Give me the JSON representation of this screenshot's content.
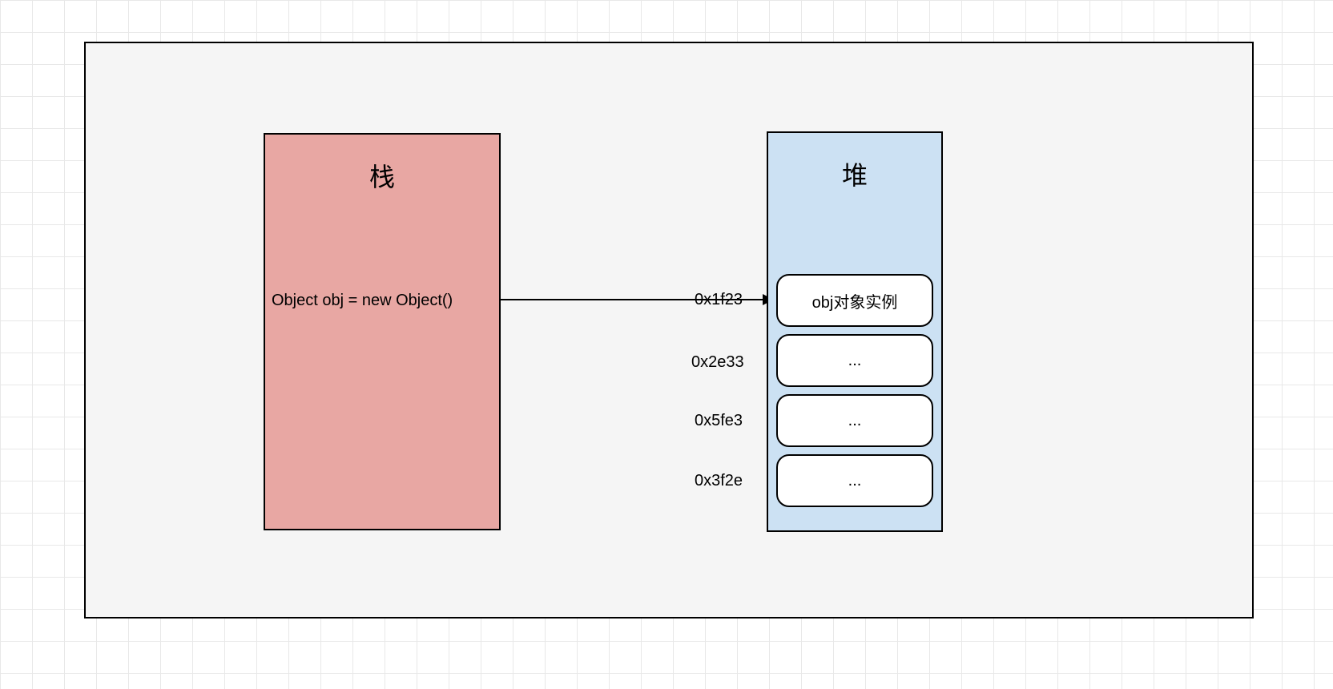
{
  "stack": {
    "title": "栈",
    "code": "Object obj = new Object()"
  },
  "heap": {
    "title": "堆",
    "entries": [
      {
        "address": "0x1f23",
        "content": "obj对象实例"
      },
      {
        "address": "0x2e33",
        "content": "..."
      },
      {
        "address": "0x5fe3",
        "content": "..."
      },
      {
        "address": "0x3f2e",
        "content": "..."
      }
    ]
  }
}
